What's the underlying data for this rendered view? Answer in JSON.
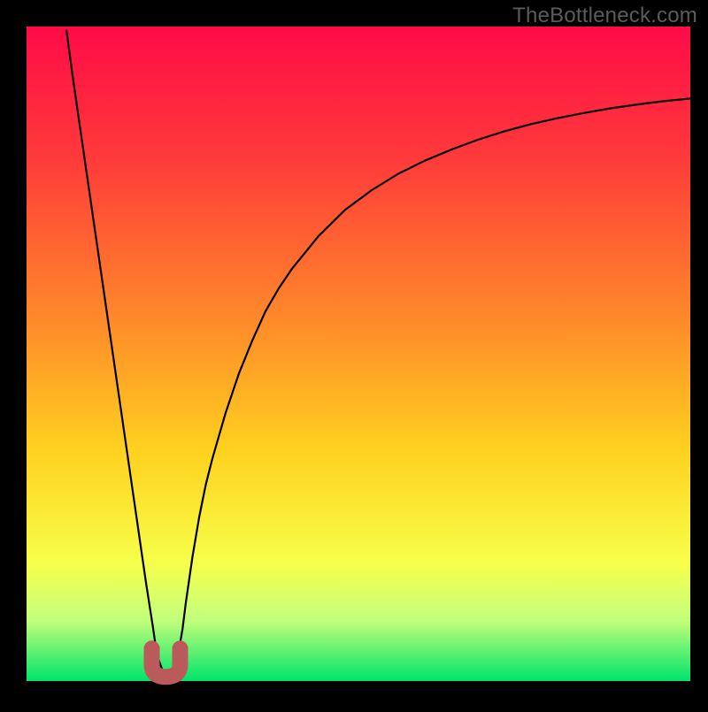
{
  "watermark": "TheBottleneck.com",
  "colors": {
    "frame": "#000000",
    "curve": "#000000",
    "marker": "#bb5a5a",
    "bottom_band_top": "#c7ff7a",
    "bottom_band_bottom": "#00e46b"
  },
  "chart_data": {
    "type": "line",
    "title": "",
    "xlabel": "",
    "ylabel": "",
    "xlim": [
      0,
      100
    ],
    "ylim": [
      0,
      100
    ],
    "gradient_stops": [
      {
        "t": 0.0,
        "color": "#ff0b47"
      },
      {
        "t": 0.2,
        "color": "#ff3a3a"
      },
      {
        "t": 0.45,
        "color": "#ff8a2a"
      },
      {
        "t": 0.65,
        "color": "#ffd21f"
      },
      {
        "t": 0.82,
        "color": "#f6ff4a"
      },
      {
        "t": 0.9,
        "color": "#c7ff7a"
      },
      {
        "t": 1.0,
        "color": "#00e46b"
      }
    ],
    "curve": {
      "x": [
        6.0,
        7.0,
        8.0,
        9.0,
        10.0,
        11.0,
        12.0,
        13.0,
        14.0,
        15.0,
        16.0,
        17.0,
        18.0,
        19.0,
        19.5,
        20.0,
        20.5,
        21.0,
        21.5,
        22.0,
        22.5,
        23.0,
        23.5,
        24.0,
        25.0,
        26.0,
        27.0,
        28.0,
        30.0,
        32.0,
        34.0,
        36.0,
        38.0,
        40.0,
        44.0,
        48.0,
        52.0,
        56.0,
        60.0,
        64.0,
        68.0,
        72.0,
        76.0,
        80.0,
        84.0,
        88.0,
        92.0,
        96.0,
        100.0
      ],
      "y": [
        99.5,
        92.0,
        85.0,
        78.0,
        71.0,
        64.0,
        57.0,
        50.0,
        43.0,
        36.0,
        29.0,
        22.0,
        15.0,
        8.5,
        5.0,
        3.0,
        1.5,
        1.0,
        1.0,
        1.5,
        3.0,
        5.0,
        8.0,
        12.0,
        19.0,
        25.0,
        30.0,
        34.0,
        41.0,
        47.0,
        52.0,
        56.5,
        60.0,
        63.0,
        68.0,
        72.0,
        75.0,
        77.5,
        79.5,
        81.2,
        82.7,
        84.0,
        85.1,
        86.0,
        86.8,
        87.5,
        88.1,
        88.6,
        89.0
      ]
    },
    "marker": {
      "x": 21.0,
      "y": 2.0,
      "shape": "U",
      "color": "#bb5a5a"
    }
  }
}
